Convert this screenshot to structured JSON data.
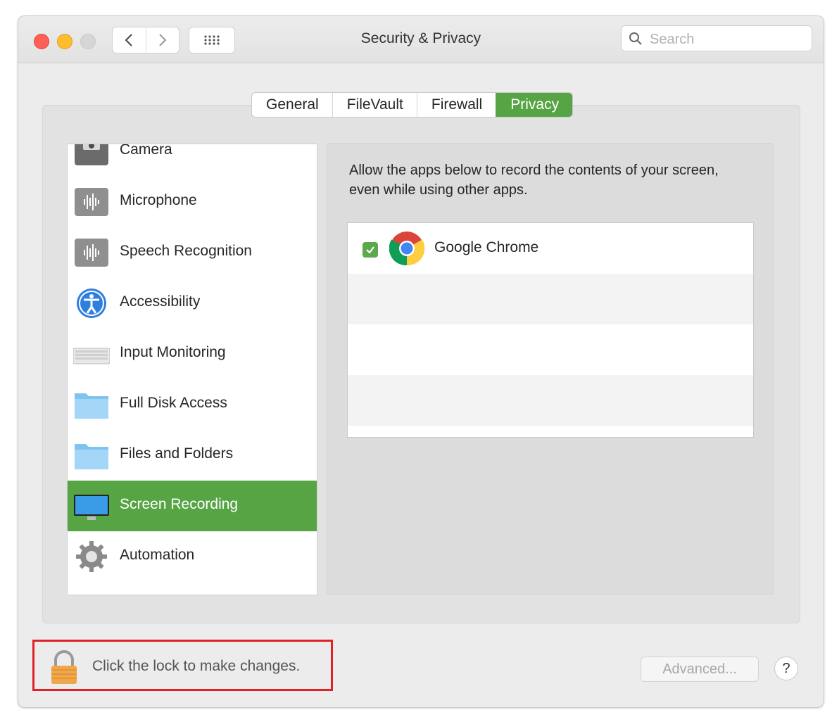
{
  "window": {
    "title": "Security & Privacy"
  },
  "search": {
    "placeholder": "Search",
    "icon": "magnifying-glass"
  },
  "toolbar": {
    "back_icon": "chevron-left",
    "forward_icon": "chevron-right",
    "grid_icon": "grid-dots"
  },
  "tabs": [
    {
      "label": "General",
      "active": false
    },
    {
      "label": "FileVault",
      "active": false
    },
    {
      "label": "Firewall",
      "active": false
    },
    {
      "label": "Privacy",
      "active": true
    }
  ],
  "sidebar": {
    "items": [
      {
        "label": "Camera",
        "icon": "camera"
      },
      {
        "label": "Microphone",
        "icon": "waveform"
      },
      {
        "label": "Speech Recognition",
        "icon": "waveform"
      },
      {
        "label": "Accessibility",
        "icon": "accessibility"
      },
      {
        "label": "Input Monitoring",
        "icon": "keyboard"
      },
      {
        "label": "Full Disk Access",
        "icon": "folder"
      },
      {
        "label": "Files and Folders",
        "icon": "folder"
      },
      {
        "label": "Screen Recording",
        "icon": "display",
        "selected": true
      },
      {
        "label": "Automation",
        "icon": "gear"
      }
    ]
  },
  "content": {
    "description": "Allow the apps below to record the contents of your screen, even while using other apps.",
    "apps": [
      {
        "name": "Google Chrome",
        "checked": true,
        "icon": "chrome"
      }
    ]
  },
  "footer": {
    "lock_text": "Click the lock to make changes.",
    "advanced_label": "Advanced...",
    "help_label": "?"
  },
  "colors": {
    "accent": "#57a445",
    "highlight_border": "#e02227"
  }
}
